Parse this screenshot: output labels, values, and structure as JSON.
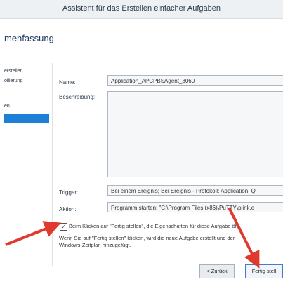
{
  "window": {
    "title": "Assistent für das Erstellen einfacher Aufgaben"
  },
  "page": {
    "heading": "menfassung"
  },
  "sidebar": {
    "items": [
      {
        "label": "erstellen"
      },
      {
        "label": "ollierung"
      },
      {
        "label": "en"
      }
    ]
  },
  "form": {
    "name_label": "Name:",
    "name_value": "Application_APCPBSAgent_3060",
    "description_label": "Beschreibung:",
    "description_value": "",
    "trigger_label": "Trigger:",
    "trigger_value": "Bei einem Ereignis; Bei Ereignis - Protokoll: Application, Q",
    "action_label": "Aktion:",
    "action_value": "Programm starten; \"C:\\Program Files (x86)\\PuTTY\\plink.e"
  },
  "checkbox": {
    "checked": true,
    "label": "Beim Klicken auf \"Fertig stellen\", die Eigenschaften für diese Aufgabe öff"
  },
  "note": {
    "line1": "Wenn Sie auf \"Fertig stellen\" klicken, wird die neue Aufgabe erstellt und der",
    "line2": "Windows-Zeitplan hinzugefügt."
  },
  "buttons": {
    "back": "< Zurück",
    "finish": "Fertig stell"
  },
  "colors": {
    "accent": "#1e7fd6",
    "arrow": "#e03a2f"
  }
}
